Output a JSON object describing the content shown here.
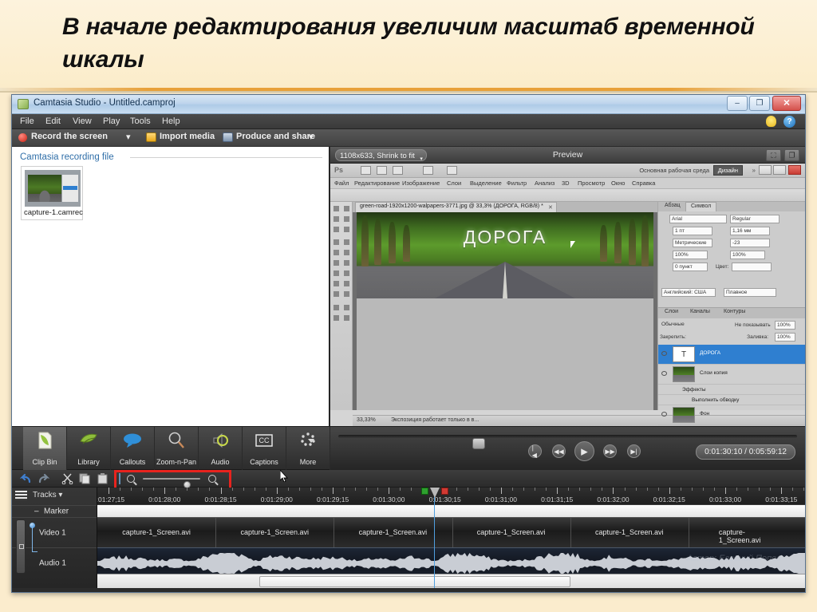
{
  "slide": {
    "title": "В начале редактирования увеличим масштаб временной шкалы"
  },
  "window": {
    "title": "Camtasia Studio - Untitled.camproj",
    "icon": "camtasia-icon",
    "minimize": "–",
    "maximize": "❐",
    "close": "✕"
  },
  "menu": {
    "items": [
      "File",
      "Edit",
      "View",
      "Play",
      "Tools",
      "Help"
    ],
    "help_icon": "?",
    "tip_icon": "lightbulb-icon"
  },
  "toolbar": {
    "record": "Record the screen",
    "import": "Import media",
    "produce": "Produce and share",
    "caret": "▾"
  },
  "clipbin": {
    "title": "Camtasia recording file",
    "clip_label": "capture-1.camrec"
  },
  "preview": {
    "dimensions": "1108x633, Shrink to fit",
    "label": "Preview",
    "caret": "▾",
    "btn_detach": "⛶",
    "btn_undock": "❐"
  },
  "photoshop": {
    "logo": "Ps",
    "workspace_label": "Основная рабочая среда",
    "workspace_button": "Дизайн",
    "chevron": "»",
    "menu": [
      "Файл",
      "Редактирование",
      "Изображение",
      "Слои",
      "Выделение",
      "Фильтр",
      "Анализ",
      "3D",
      "Просмотр",
      "Окно",
      "Справка"
    ],
    "document_tab": "green-road-1920x1200-walpapers-3771.jpg @ 33,3% (ДОРОГА, RGB/8) *",
    "tab_close": "✕",
    "canvas_text": "ДОРОГА",
    "status_zoom": "33,33%",
    "status_message": "Экспозиция работает только в в...",
    "panel_tabs": [
      "Абзац",
      "Символ"
    ],
    "character": {
      "font": "Arial",
      "style": "Regular",
      "size": "1 пт",
      "leading": "1,16 мм",
      "kerning": "Метрические",
      "tracking": "-23",
      "vscale": "100%",
      "hscale": "100%",
      "baseline": "0 пункт",
      "color_label": "Цвет:",
      "language": "Английский: США",
      "antialias": "Плавное"
    },
    "layers_tabs": [
      "Слои",
      "Каналы",
      "Контуры"
    ],
    "blend_mode": "Обычные",
    "opacity_label": "Не показывать",
    "opacity": "100%",
    "lock_label": "Закрепить:",
    "fill_label": "Заливка:",
    "fill": "100%",
    "layers": [
      {
        "name": "ДОРОГА",
        "type": "text",
        "selected": true
      },
      {
        "name": "Слои копия",
        "type": "photo",
        "selected": false
      },
      {
        "name": "Эффекты",
        "type": "effect",
        "selected": false
      },
      {
        "name": "Выполнить обводку",
        "type": "effect",
        "selected": false
      },
      {
        "name": "Фон",
        "type": "photo",
        "selected": false
      }
    ]
  },
  "tool_strip": {
    "buttons": [
      {
        "label": "Clip Bin",
        "icon": "clipbin-icon",
        "active": true
      },
      {
        "label": "Library",
        "icon": "library-icon",
        "active": false
      },
      {
        "label": "Callouts",
        "icon": "callout-icon",
        "active": false
      },
      {
        "label": "Zoom-n-Pan",
        "icon": "magnifier-icon",
        "active": false
      },
      {
        "label": "Audio",
        "icon": "speaker-icon",
        "active": false
      },
      {
        "label": "Captions",
        "icon": "cc-icon",
        "active": false
      },
      {
        "label": "More",
        "icon": "more-icon",
        "active": false
      }
    ]
  },
  "player": {
    "first": "|◀",
    "rewind": "◀◀",
    "play": "▶",
    "forward": "▶▶",
    "last": "▶|",
    "timecode": "0:01:30:10 / 0:05:59:12"
  },
  "timeline": {
    "tools": [
      "undo-icon",
      "redo-icon",
      "cut-icon",
      "copy-icon",
      "paste-icon",
      "split-icon"
    ],
    "zoom_out_icon": "zoom-out-icon",
    "zoom_in_icon": "zoom-in-icon",
    "zoom_slider_value": 65,
    "highlight_color": "#e8231e",
    "tracks_label": "Tracks",
    "tracks_caret": "▾",
    "rows": [
      {
        "name": "Marker",
        "prefix": "–"
      },
      {
        "name": "Video 1"
      },
      {
        "name": "Audio 1"
      }
    ],
    "ruler_labels": [
      "0:01:27;15",
      "0:01:28;00",
      "0:01:28;15",
      "0:01:29;00",
      "0:01:29;15",
      "0:01:30;00",
      "0:01:30;15",
      "0:01:31;00",
      "0:01:31;15",
      "0:01:32;00",
      "0:01:32;15",
      "0:01:33;00",
      "0:01:33;15"
    ],
    "clips": [
      "capture-1_Screen.avi",
      "capture-1_Screen.avi",
      "capture-1_Screen.avi",
      "capture-1_Screen.avi",
      "capture-1_Screen.avi",
      "capture-1_Screen.avi"
    ],
    "watermark": "Автор: Евгений Попов"
  }
}
